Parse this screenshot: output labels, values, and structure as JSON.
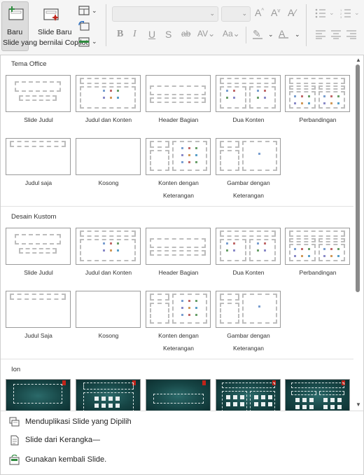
{
  "ribbon": {
    "new_slide_label_1": "Baru",
    "new_slide_label_2": "Slide yang bernilai Copilot",
    "slide_baru_label": "Slide Baru"
  },
  "sections": [
    {
      "title": "Tema Office",
      "layouts": [
        "Slide Judul",
        "Judul dan Konten",
        "Header Bagian",
        "Dua Konten",
        "Perbandingan",
        "Judul saja",
        "Kosong",
        "Konten dengan Keterangan",
        "Gambar dengan Keterangan"
      ]
    },
    {
      "title": "Desain Kustom",
      "layouts": [
        "Slide Judul",
        "Judul dan Konten",
        "Header Bagian",
        "Dua Konten",
        "Perbandingan",
        "Judul Saja",
        "Kosong",
        "Konten dengan Keterangan",
        "Gambar dengan Keterangan"
      ]
    },
    {
      "title": "Ion",
      "layouts": []
    }
  ],
  "menu": {
    "duplicate": "Menduplikasi Slide yang Dipilih",
    "from_outline": "Slide dari Kerangka—",
    "reuse": "Gunakan kembali Slide."
  },
  "icons": {
    "new_slide": "new-slide-icon",
    "copilot_slide": "copilot-slide-icon",
    "duplicate": "duplicate-icon",
    "outline": "outline-icon",
    "reuse": "reuse-icon"
  },
  "colors": {
    "accent_red": "#c0241a",
    "ion_theme": "#164545",
    "placeholder_blue": "#4a8fd8"
  }
}
